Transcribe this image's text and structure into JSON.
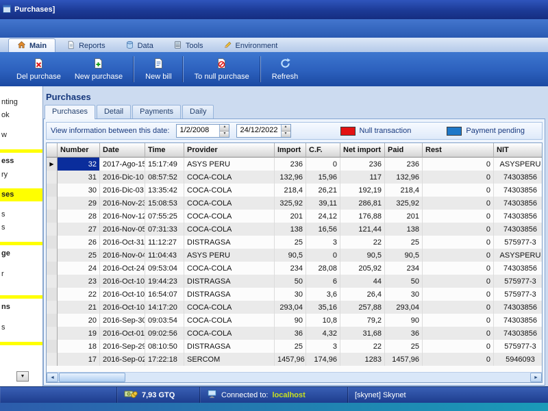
{
  "window": {
    "title": "Purchases]"
  },
  "icons": {
    "row_marker": "▶",
    "scroll_left": "◄",
    "scroll_right": "►",
    "spin_up": "▲",
    "spin_down": "▼",
    "sidebar_scroll_down": "▼"
  },
  "ribbon": {
    "tabs": [
      {
        "label": "Main"
      },
      {
        "label": "Reports"
      },
      {
        "label": "Data"
      },
      {
        "label": "Tools"
      },
      {
        "label": "Environment"
      }
    ]
  },
  "toolbar": {
    "buttons": [
      {
        "label": "Del purchase"
      },
      {
        "label": "New purchase"
      },
      {
        "label": "New bill"
      },
      {
        "label": "To null purchase"
      },
      {
        "label": "Refresh"
      }
    ]
  },
  "sidebar": {
    "highlight_color": "#ffff00",
    "items": [
      {
        "type": "item",
        "label": "nting"
      },
      {
        "type": "item",
        "label": "ok"
      },
      {
        "type": "blank"
      },
      {
        "type": "item",
        "label": "w"
      },
      {
        "type": "blank"
      },
      {
        "type": "sep"
      },
      {
        "type": "header",
        "label": "ess"
      },
      {
        "type": "item",
        "label": "ry"
      },
      {
        "type": "blank"
      },
      {
        "type": "highlight",
        "label": "ses"
      },
      {
        "type": "blank"
      },
      {
        "type": "item",
        "label": "s"
      },
      {
        "type": "item",
        "label": "s"
      },
      {
        "type": "blank"
      },
      {
        "type": "sep"
      },
      {
        "type": "header",
        "label": "ge"
      },
      {
        "type": "blank"
      },
      {
        "type": "item",
        "label": "r"
      },
      {
        "type": "blank"
      },
      {
        "type": "blank"
      },
      {
        "type": "sep"
      },
      {
        "type": "header",
        "label": "ns"
      },
      {
        "type": "blank"
      },
      {
        "type": "item",
        "label": "s"
      },
      {
        "type": "blank"
      },
      {
        "type": "sep"
      }
    ]
  },
  "main": {
    "title": "Purchases",
    "tabs": [
      {
        "label": "Purchases"
      },
      {
        "label": "Detail"
      },
      {
        "label": "Payments"
      },
      {
        "label": "Daily"
      }
    ],
    "filter": {
      "label": "View information between this date:",
      "date_from": "1/2/2008",
      "date_to": "24/12/2022",
      "legend": [
        {
          "label": "Null transaction",
          "color": "#e31212"
        },
        {
          "label": "Payment pending",
          "color": "#1e78c8"
        }
      ]
    },
    "grid": {
      "columns": [
        "Number",
        "Date",
        "Time",
        "Provider",
        "Import",
        "C.F.",
        "Net import",
        "Paid",
        "Rest",
        "NIT"
      ],
      "selected_row_index": 0,
      "rows": [
        [
          "32",
          "2017-Ago-15",
          "15:17:49",
          "ASYS PERU",
          "236",
          "0",
          "236",
          "236",
          "0",
          "ASYSPERU"
        ],
        [
          "31",
          "2016-Dic-10",
          "08:57:52",
          "COCA-COLA",
          "132,96",
          "15,96",
          "117",
          "132,96",
          "0",
          "74303856"
        ],
        [
          "30",
          "2016-Dic-03",
          "13:35:42",
          "COCA-COLA",
          "218,4",
          "26,21",
          "192,19",
          "218,4",
          "0",
          "74303856"
        ],
        [
          "29",
          "2016-Nov-23",
          "15:08:53",
          "COCA-COLA",
          "325,92",
          "39,11",
          "286,81",
          "325,92",
          "0",
          "74303856"
        ],
        [
          "28",
          "2016-Nov-12",
          "07:55:25",
          "COCA-COLA",
          "201",
          "24,12",
          "176,88",
          "201",
          "0",
          "74303856"
        ],
        [
          "27",
          "2016-Nov-05",
          "07:31:33",
          "COCA-COLA",
          "138",
          "16,56",
          "121,44",
          "138",
          "0",
          "74303856"
        ],
        [
          "26",
          "2016-Oct-31",
          "11:12:27",
          "DISTRAGSA",
          "25",
          "3",
          "22",
          "25",
          "0",
          "575977-3"
        ],
        [
          "25",
          "2016-Nov-04",
          "11:04:43",
          "ASYS PERU",
          "90,5",
          "0",
          "90,5",
          "90,5",
          "0",
          "ASYSPERU"
        ],
        [
          "24",
          "2016-Oct-24",
          "09:53:04",
          "COCA-COLA",
          "234",
          "28,08",
          "205,92",
          "234",
          "0",
          "74303856"
        ],
        [
          "23",
          "2016-Oct-10",
          "19:44:23",
          "DISTRAGSA",
          "50",
          "6",
          "44",
          "50",
          "0",
          "575977-3"
        ],
        [
          "22",
          "2016-Oct-10",
          "16:54:07",
          "DISTRAGSA",
          "30",
          "3,6",
          "26,4",
          "30",
          "0",
          "575977-3"
        ],
        [
          "21",
          "2016-Oct-10",
          "14:17:20",
          "COCA-COLA",
          "293,04",
          "35,16",
          "257,88",
          "293,04",
          "0",
          "74303856"
        ],
        [
          "20",
          "2016-Sep-30",
          "09:03:54",
          "COCA-COLA",
          "90",
          "10,8",
          "79,2",
          "90",
          "0",
          "74303856"
        ],
        [
          "19",
          "2016-Oct-01",
          "09:02:56",
          "COCA-COLA",
          "36",
          "4,32",
          "31,68",
          "36",
          "0",
          "74303856"
        ],
        [
          "18",
          "2016-Sep-29",
          "08:10:50",
          "DISTRAGSA",
          "25",
          "3",
          "22",
          "25",
          "0",
          "575977-3"
        ],
        [
          "17",
          "2016-Sep-02",
          "17:22:18",
          "SERCOM",
          "1457,96",
          "174,96",
          "1283",
          "1457,96",
          "0",
          "5946093"
        ]
      ]
    }
  },
  "statusbar": {
    "money": "7,93 GTQ",
    "connected_label": "Connected to:",
    "connected_value": "localhost",
    "connected_value_color": "#c8e020",
    "user": "[skynet] Skynet"
  }
}
